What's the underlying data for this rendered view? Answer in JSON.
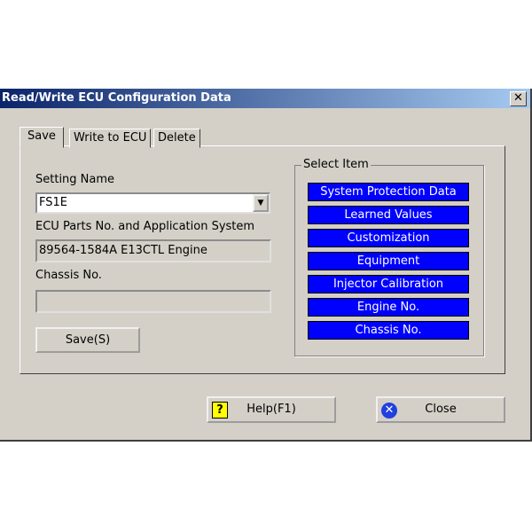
{
  "window": {
    "title": "Read/Write ECU Configuration Data",
    "close_glyph": "✕"
  },
  "tabs": [
    {
      "label": "Save",
      "active": true
    },
    {
      "label": "Write to ECU"
    },
    {
      "label": "Delete"
    }
  ],
  "save_tab": {
    "setting_name_label": "Setting Name",
    "setting_name_value": "FS1E",
    "ecu_parts_label": "ECU Parts No. and Application System",
    "ecu_parts_value": "89564-1584A E13CTL Engine",
    "chassis_label": "Chassis No.",
    "chassis_value": "",
    "save_button": "Save(S)"
  },
  "select_item": {
    "label": "Select Item",
    "items": [
      "System Protection Data",
      "Learned Values",
      "Customization",
      "Equipment",
      "Injector Calibration",
      "Engine No.",
      "Chassis No."
    ],
    "color": "#0000ff"
  },
  "footer": {
    "help_button": "Help(F1)",
    "close_button": "Close"
  }
}
